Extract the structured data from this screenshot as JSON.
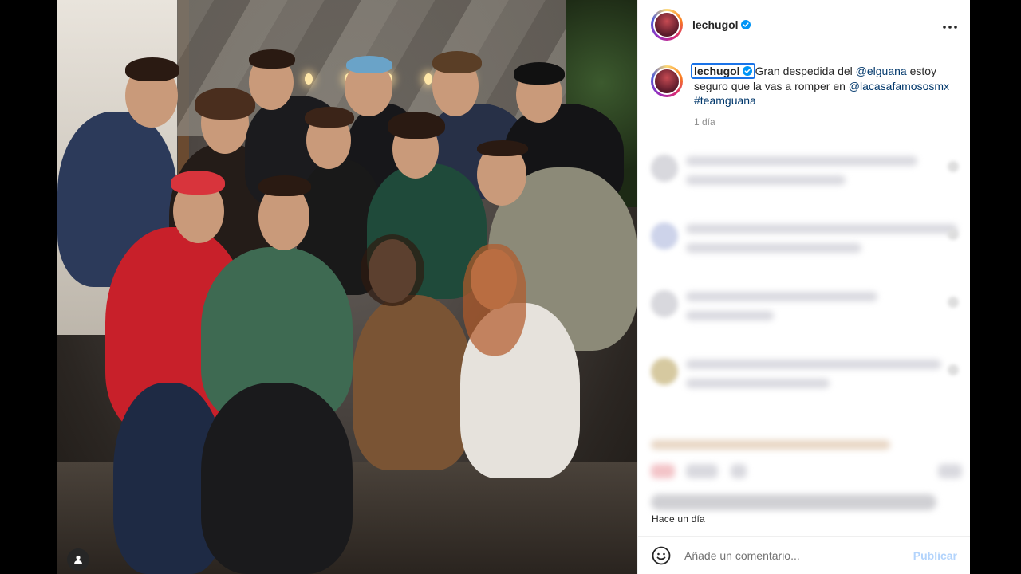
{
  "post": {
    "username": "lechugol",
    "more_icon": "more-horizontal-icon",
    "caption": {
      "username": "lechugol",
      "text_1": "Gran despedida del ",
      "mention_1": "@elguana",
      "text_2": " estoy seguro que la vas a romper en ",
      "mention_2": "@lacasafamososmx",
      "text_3": " ",
      "hashtag": "#teamguana",
      "time": "1 día"
    },
    "time_ago": "Hace un día"
  },
  "add_comment": {
    "placeholder": "Añade un comentario...",
    "publish_label": "Publicar",
    "emoji_icon": "emoji-icon"
  },
  "colors": {
    "verified": "#0095f6",
    "link": "#00376b",
    "publish_disabled": "#b3d4fc"
  }
}
